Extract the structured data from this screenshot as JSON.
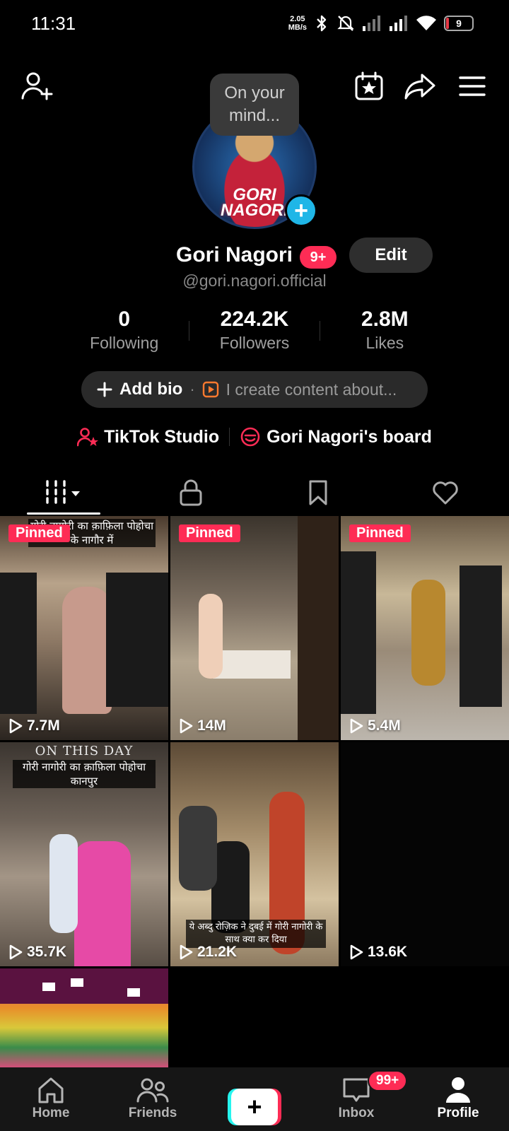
{
  "status_bar": {
    "time": "11:31",
    "net_speed_value": "2.05",
    "net_speed_unit": "MB/s",
    "battery": "9",
    "battery_level": 0.09,
    "battery_color": "#e53946",
    "icons": [
      "bluetooth-icon",
      "mute-icon",
      "signal-icon",
      "signal-icon",
      "wifi-icon",
      "battery-icon"
    ]
  },
  "header": {
    "add_friend_icon": "person-add-icon",
    "right_icons": [
      "calendar-star-icon",
      "share-icon",
      "menu-icon"
    ]
  },
  "profile": {
    "mind_prompt_line1": "On your",
    "mind_prompt_line2": "mind...",
    "avatar_text_line1": "GORI",
    "avatar_text_line2": "NAGORI",
    "display_name": "Gori Nagori",
    "notification_badge": "9+",
    "edit_label": "Edit",
    "username": "@gori.nagori.official"
  },
  "stats": [
    {
      "value": "0",
      "label": "Following"
    },
    {
      "value": "224.2K",
      "label": "Followers"
    },
    {
      "value": "2.8M",
      "label": "Likes"
    }
  ],
  "bio": {
    "add_label": "Add bio",
    "separator": "·",
    "placeholder": "I create content about..."
  },
  "links": {
    "studio": "TikTok Studio",
    "board": "Gori Nagori's board"
  },
  "tabs": [
    "videos-grid-tab",
    "private-tab",
    "favorites-tab",
    "liked-tab"
  ],
  "videos": [
    {
      "pinned": "Pinned",
      "views": "7.7M",
      "overlay": "गोरी नागोरी का क़ाफ़िला पोहोचा के नागौर में"
    },
    {
      "pinned": "Pinned",
      "views": "14M"
    },
    {
      "pinned": "Pinned",
      "views": "5.4M"
    },
    {
      "views": "35.7K",
      "overlay_title": "ON THIS DAY",
      "overlay": "गोरी नागोरी का क़ाफ़िला पोहोचा कानपुर"
    },
    {
      "views": "21.2K",
      "caption": "ये अब्दु रोज़िक ने दुबई में गोरी नागोरी के साथ क्या कर दिया"
    },
    {
      "views": "13.6K"
    },
    {}
  ],
  "bottom_nav": {
    "home": "Home",
    "friends": "Friends",
    "inbox": "Inbox",
    "inbox_badge": "99+",
    "profile": "Profile"
  },
  "colors": {
    "accent": "#fe2c55",
    "cyan": "#25f4ee",
    "avatar_add": "#1fb6e7",
    "background": "#000000"
  }
}
